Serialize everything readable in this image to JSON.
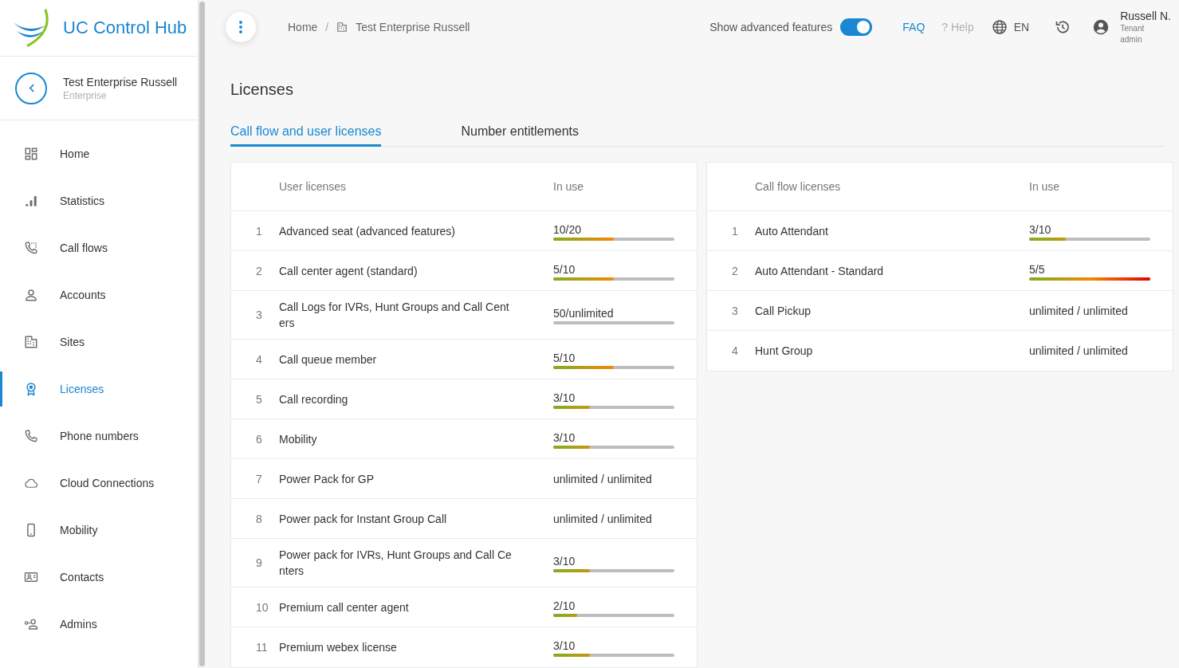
{
  "sidebar": {
    "brand": "UC Control Hub",
    "context": {
      "name": "Test Enterprise Russell",
      "type": "Enterprise"
    },
    "items": [
      {
        "label": "Home",
        "selected": false
      },
      {
        "label": "Statistics",
        "selected": false
      },
      {
        "label": "Call flows",
        "selected": false
      },
      {
        "label": "Accounts",
        "selected": false
      },
      {
        "label": "Sites",
        "selected": false
      },
      {
        "label": "Licenses",
        "selected": true
      },
      {
        "label": "Phone numbers",
        "selected": false
      },
      {
        "label": "Cloud Connections",
        "selected": false
      },
      {
        "label": "Mobility",
        "selected": false
      },
      {
        "label": "Contacts",
        "selected": false
      },
      {
        "label": "Admins",
        "selected": false
      }
    ]
  },
  "topbar": {
    "breadcrumb": {
      "separator": "/",
      "items": [
        {
          "label": "Home"
        },
        {
          "label": "Test Enterprise Russell"
        }
      ]
    },
    "advanced_toggle": {
      "label": "Show advanced features",
      "on": true
    },
    "links": [
      {
        "label": "FAQ",
        "disabled": false
      },
      {
        "label": "? Help",
        "disabled": true
      }
    ],
    "language": "EN",
    "user": {
      "name": "Russell N.",
      "role": "Tenant admin"
    }
  },
  "page": {
    "title": "Licenses",
    "tabs": [
      {
        "label": "Call flow and user licenses",
        "selected": true
      },
      {
        "label": "Number entitlements",
        "selected": false
      }
    ],
    "tables": [
      {
        "columns": [
          "User licenses",
          "In use"
        ],
        "rows": [
          {
            "index": "1",
            "name": "Advanced seat (advanced features)",
            "kind": "bar",
            "usage": "10/20",
            "level": 0.5
          },
          {
            "index": "2",
            "name": "Call center agent (standard)",
            "kind": "bar",
            "usage": "5/10",
            "level": 0.5
          },
          {
            "index": "3",
            "name": "Call Logs for IVRs, Hunt Groups and Call Centers",
            "kind": "bar",
            "usage": "50/unlimited",
            "level": 0
          },
          {
            "index": "4",
            "name": "Call queue member",
            "kind": "bar",
            "usage": "5/10",
            "level": 0.5
          },
          {
            "index": "5",
            "name": "Call recording",
            "kind": "bar",
            "usage": "3/10",
            "level": 0.3
          },
          {
            "index": "6",
            "name": "Mobility",
            "kind": "bar",
            "usage": "3/10",
            "level": 0.3
          },
          {
            "index": "7",
            "name": "Power Pack for GP",
            "kind": "text",
            "usage": "unlimited / unlimited"
          },
          {
            "index": "8",
            "name": "Power pack for Instant Group Call",
            "kind": "text",
            "usage": "unlimited / unlimited"
          },
          {
            "index": "9",
            "name": "Power pack for IVRs, Hunt Groups and Call Centers",
            "kind": "bar",
            "usage": "3/10",
            "level": 0.3
          },
          {
            "index": "10",
            "name": "Premium call center agent",
            "kind": "bar",
            "usage": "2/10",
            "level": 0.2
          },
          {
            "index": "11",
            "name": "Premium webex license",
            "kind": "bar",
            "usage": "3/10",
            "level": 0.3
          }
        ]
      },
      {
        "columns": [
          "Call flow licenses",
          "In use"
        ],
        "rows": [
          {
            "index": "1",
            "name": "Auto Attendant",
            "kind": "bar",
            "usage": "3/10",
            "level": 0.3
          },
          {
            "index": "2",
            "name": "Auto Attendant - Standard",
            "kind": "bar",
            "usage": "5/5",
            "level": 1
          },
          {
            "index": "3",
            "name": "Call Pickup",
            "kind": "text",
            "usage": "unlimited / unlimited"
          },
          {
            "index": "4",
            "name": "Hunt Group",
            "kind": "text",
            "usage": "unlimited / unlimited"
          }
        ]
      }
    ]
  }
}
